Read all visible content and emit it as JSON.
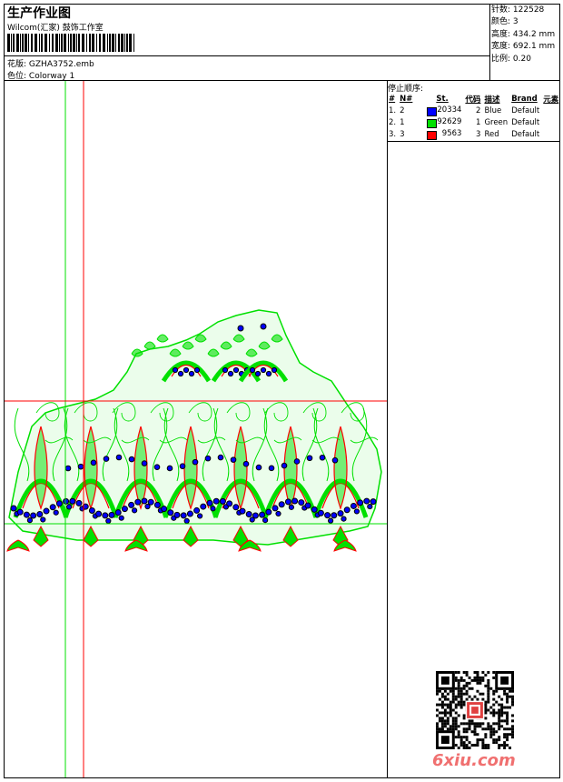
{
  "header": {
    "title": "生产作业图",
    "company": "Wilcom(汇家) 鼓饰工作室",
    "design_label": "花版:",
    "design_file": "GZHA3752.emb",
    "colorway_label": "色位:",
    "colorway": "Colorway 1"
  },
  "stats": {
    "stitches_label": "针数:",
    "stitches": "122528",
    "colors_label": "颜色:",
    "colors": "3",
    "height_label": "高度:",
    "height": "434.2 mm",
    "width_label": "宽度:",
    "width": "692.1 mm",
    "scale_label": "比例:",
    "scale": "0.20"
  },
  "stop_sequence": {
    "title": "停止顺序:",
    "columns": [
      "#",
      "N#",
      "St.",
      "代码",
      "描述",
      "Brand",
      "元素"
    ],
    "rows": [
      {
        "idx": "1.",
        "n": "2",
        "color": "#0000ff",
        "stitches": "20334",
        "code": "2",
        "desc": "Blue",
        "brand": "Default"
      },
      {
        "idx": "2.",
        "n": "1",
        "color": "#00e000",
        "stitches": "92629",
        "code": "1",
        "desc": "Green",
        "brand": "Default"
      },
      {
        "idx": "3.",
        "n": "3",
        "color": "#ff0000",
        "stitches": "9563",
        "code": "3",
        "desc": "Red",
        "brand": "Default"
      }
    ]
  },
  "watermark": {
    "text": "6xiu.com"
  },
  "colors": {
    "blue": "#0000ff",
    "green": "#00e000",
    "red": "#ff0000"
  }
}
